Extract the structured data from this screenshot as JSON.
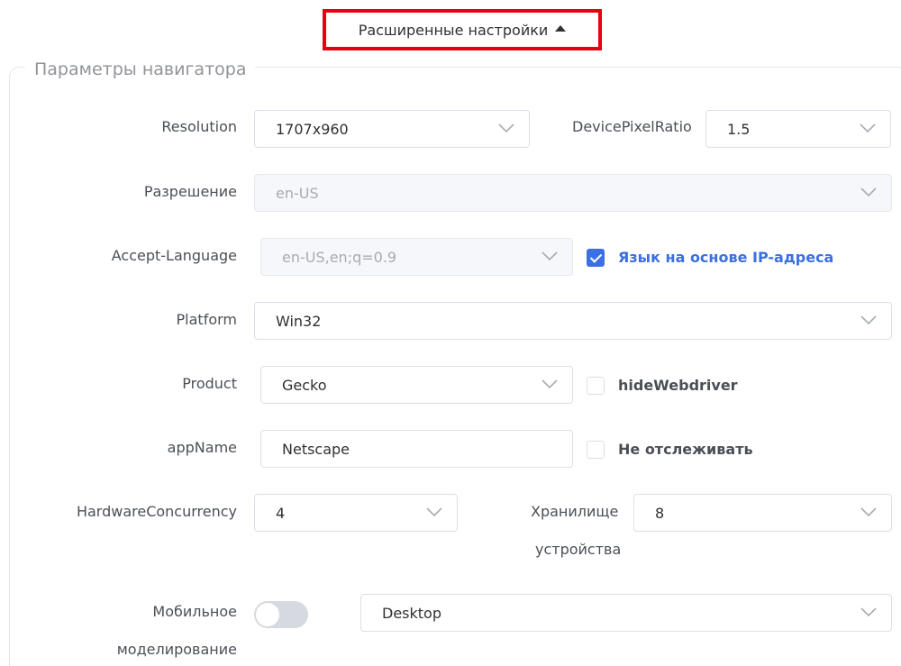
{
  "header": {
    "toggle_label": "Расширенные настройки",
    "highlight_color": "#e60012"
  },
  "section": {
    "title": "Параметры навигатора"
  },
  "form": {
    "resolution": {
      "label": "Resolution",
      "value": "1707x960"
    },
    "device_pixel_ratio": {
      "label": "DevicePixelRatio",
      "value": "1.5"
    },
    "locale": {
      "label": "Разрешение",
      "value": "en-US",
      "disabled": true
    },
    "accept_language": {
      "label": "Accept-Language",
      "value": "en-US,en;q=0.9",
      "disabled": true,
      "checkbox_label": "Язык на основе IP-адреса",
      "checkbox_checked": true
    },
    "platform": {
      "label": "Platform",
      "value": "Win32"
    },
    "product": {
      "label": "Product",
      "value": "Gecko",
      "checkbox_label": "hideWebdriver",
      "checkbox_checked": false
    },
    "app_name": {
      "label": "appName",
      "value": "Netscape",
      "checkbox_label": "Не отслеживать",
      "checkbox_checked": false
    },
    "hardware_concurrency": {
      "label": "HardwareConcurrency",
      "value": "4"
    },
    "device_memory": {
      "label_line1": "Хранилище",
      "label_line2": "устройства",
      "value": "8"
    },
    "mobile_emulation": {
      "label_line1": "Мобильное",
      "label_line2": "моделирование",
      "switch_on": false,
      "device_value": "Desktop"
    }
  },
  "colors": {
    "accent": "#3b6fe3",
    "border": "#dcdfe6",
    "disabled_bg": "#f5f7fa"
  },
  "icons": {
    "chevron": "chevron-down-icon",
    "caret": "caret-up-icon",
    "check": "check-icon"
  }
}
